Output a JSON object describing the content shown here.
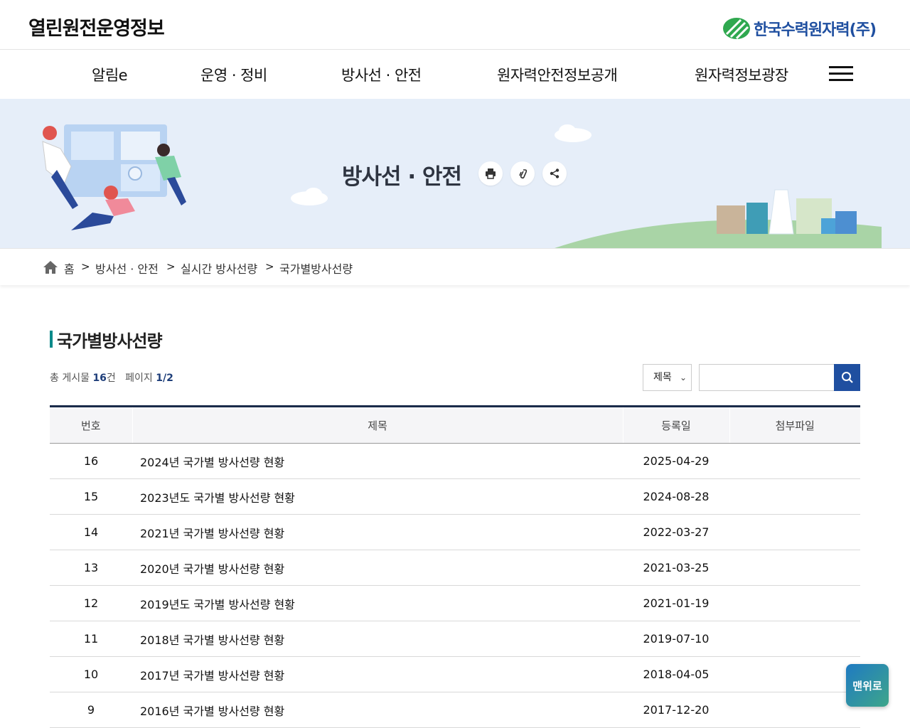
{
  "header": {
    "site_title": "열린원전운영정보",
    "logo_text": "한국수력원자력(주)"
  },
  "gnb": {
    "items": [
      {
        "label": "알림e"
      },
      {
        "label": "운영 · 정비"
      },
      {
        "label": "방사선 · 안전"
      },
      {
        "label": "원자력안전정보공개"
      },
      {
        "label": "원자력정보광장"
      }
    ]
  },
  "banner": {
    "title": "방사선 · 안전"
  },
  "breadcrumb": {
    "items": [
      "홈",
      "방사선 · 안전",
      "실시간 방사선량",
      "국가별방사선량"
    ],
    "separator": ">"
  },
  "page": {
    "title": "국가별방사선량",
    "total_label": "총 게시물",
    "total_count": "16",
    "total_unit": "건",
    "page_label": "페이지",
    "page_value": "1/2"
  },
  "search": {
    "select_value": "제목",
    "input_value": "",
    "accent": "#1f4fa0"
  },
  "table": {
    "headers": [
      "번호",
      "제목",
      "등록일",
      "첨부파일"
    ],
    "rows": [
      {
        "num": "16",
        "title": "2024년 국가별 방사선량 현황",
        "date": "2025-04-29",
        "file": ""
      },
      {
        "num": "15",
        "title": "2023년도 국가별 방사선량 현황",
        "date": "2024-08-28",
        "file": ""
      },
      {
        "num": "14",
        "title": "2021년 국가별 방사선량 현황",
        "date": "2022-03-27",
        "file": ""
      },
      {
        "num": "13",
        "title": "2020년 국가별 방사선량 현황",
        "date": "2021-03-25",
        "file": ""
      },
      {
        "num": "12",
        "title": "2019년도 국가별 방사선량 현황",
        "date": "2021-01-19",
        "file": ""
      },
      {
        "num": "11",
        "title": "2018년 국가별 방사선량 현황",
        "date": "2019-07-10",
        "file": ""
      },
      {
        "num": "10",
        "title": "2017년 국가별 방사선량 현황",
        "date": "2018-04-05",
        "file": ""
      },
      {
        "num": "9",
        "title": "2016년 국가별 방사선량 현황",
        "date": "2017-12-20",
        "file": ""
      }
    ]
  },
  "top_button": {
    "label": "맨위로"
  }
}
